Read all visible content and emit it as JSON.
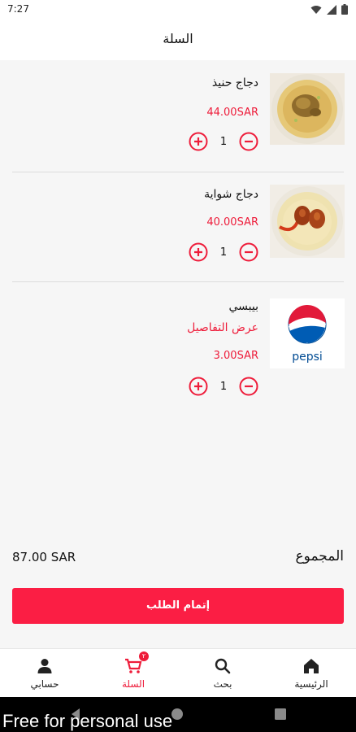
{
  "status_bar": {
    "time": "7:27"
  },
  "header": {
    "title": "السلة"
  },
  "items": [
    {
      "name": "دجاج حنيذ",
      "price": "44.00SAR",
      "quantity": "1",
      "image_icon": "haneeth-chicken-plate"
    },
    {
      "name": "دجاج شواية",
      "price": "40.00SAR",
      "quantity": "1",
      "image_icon": "grilled-chicken-plate"
    },
    {
      "name": "بيبسي",
      "details_link": "عرض التفاصيل",
      "price": "3.00SAR",
      "quantity": "1",
      "image_icon": "pepsi-logo",
      "logo_text": "pepsi"
    }
  ],
  "summary": {
    "total_label": "المجموع",
    "total_value": "87.00 SAR"
  },
  "checkout": {
    "label": "إتمام الطلب"
  },
  "bottom_nav": {
    "items": [
      {
        "label": "الرئيسية",
        "icon": "home-icon"
      },
      {
        "label": "بحث",
        "icon": "search-icon"
      },
      {
        "label": "السلة",
        "icon": "cart-icon",
        "badge": "٢"
      },
      {
        "label": "حسابي",
        "icon": "person-icon"
      }
    ],
    "active_index": 2
  },
  "watermark": {
    "text": "Free for personal use"
  },
  "colors": {
    "accent": "#ee1c3a",
    "checkout": "#fb1e44",
    "background": "#f6f6f6"
  }
}
